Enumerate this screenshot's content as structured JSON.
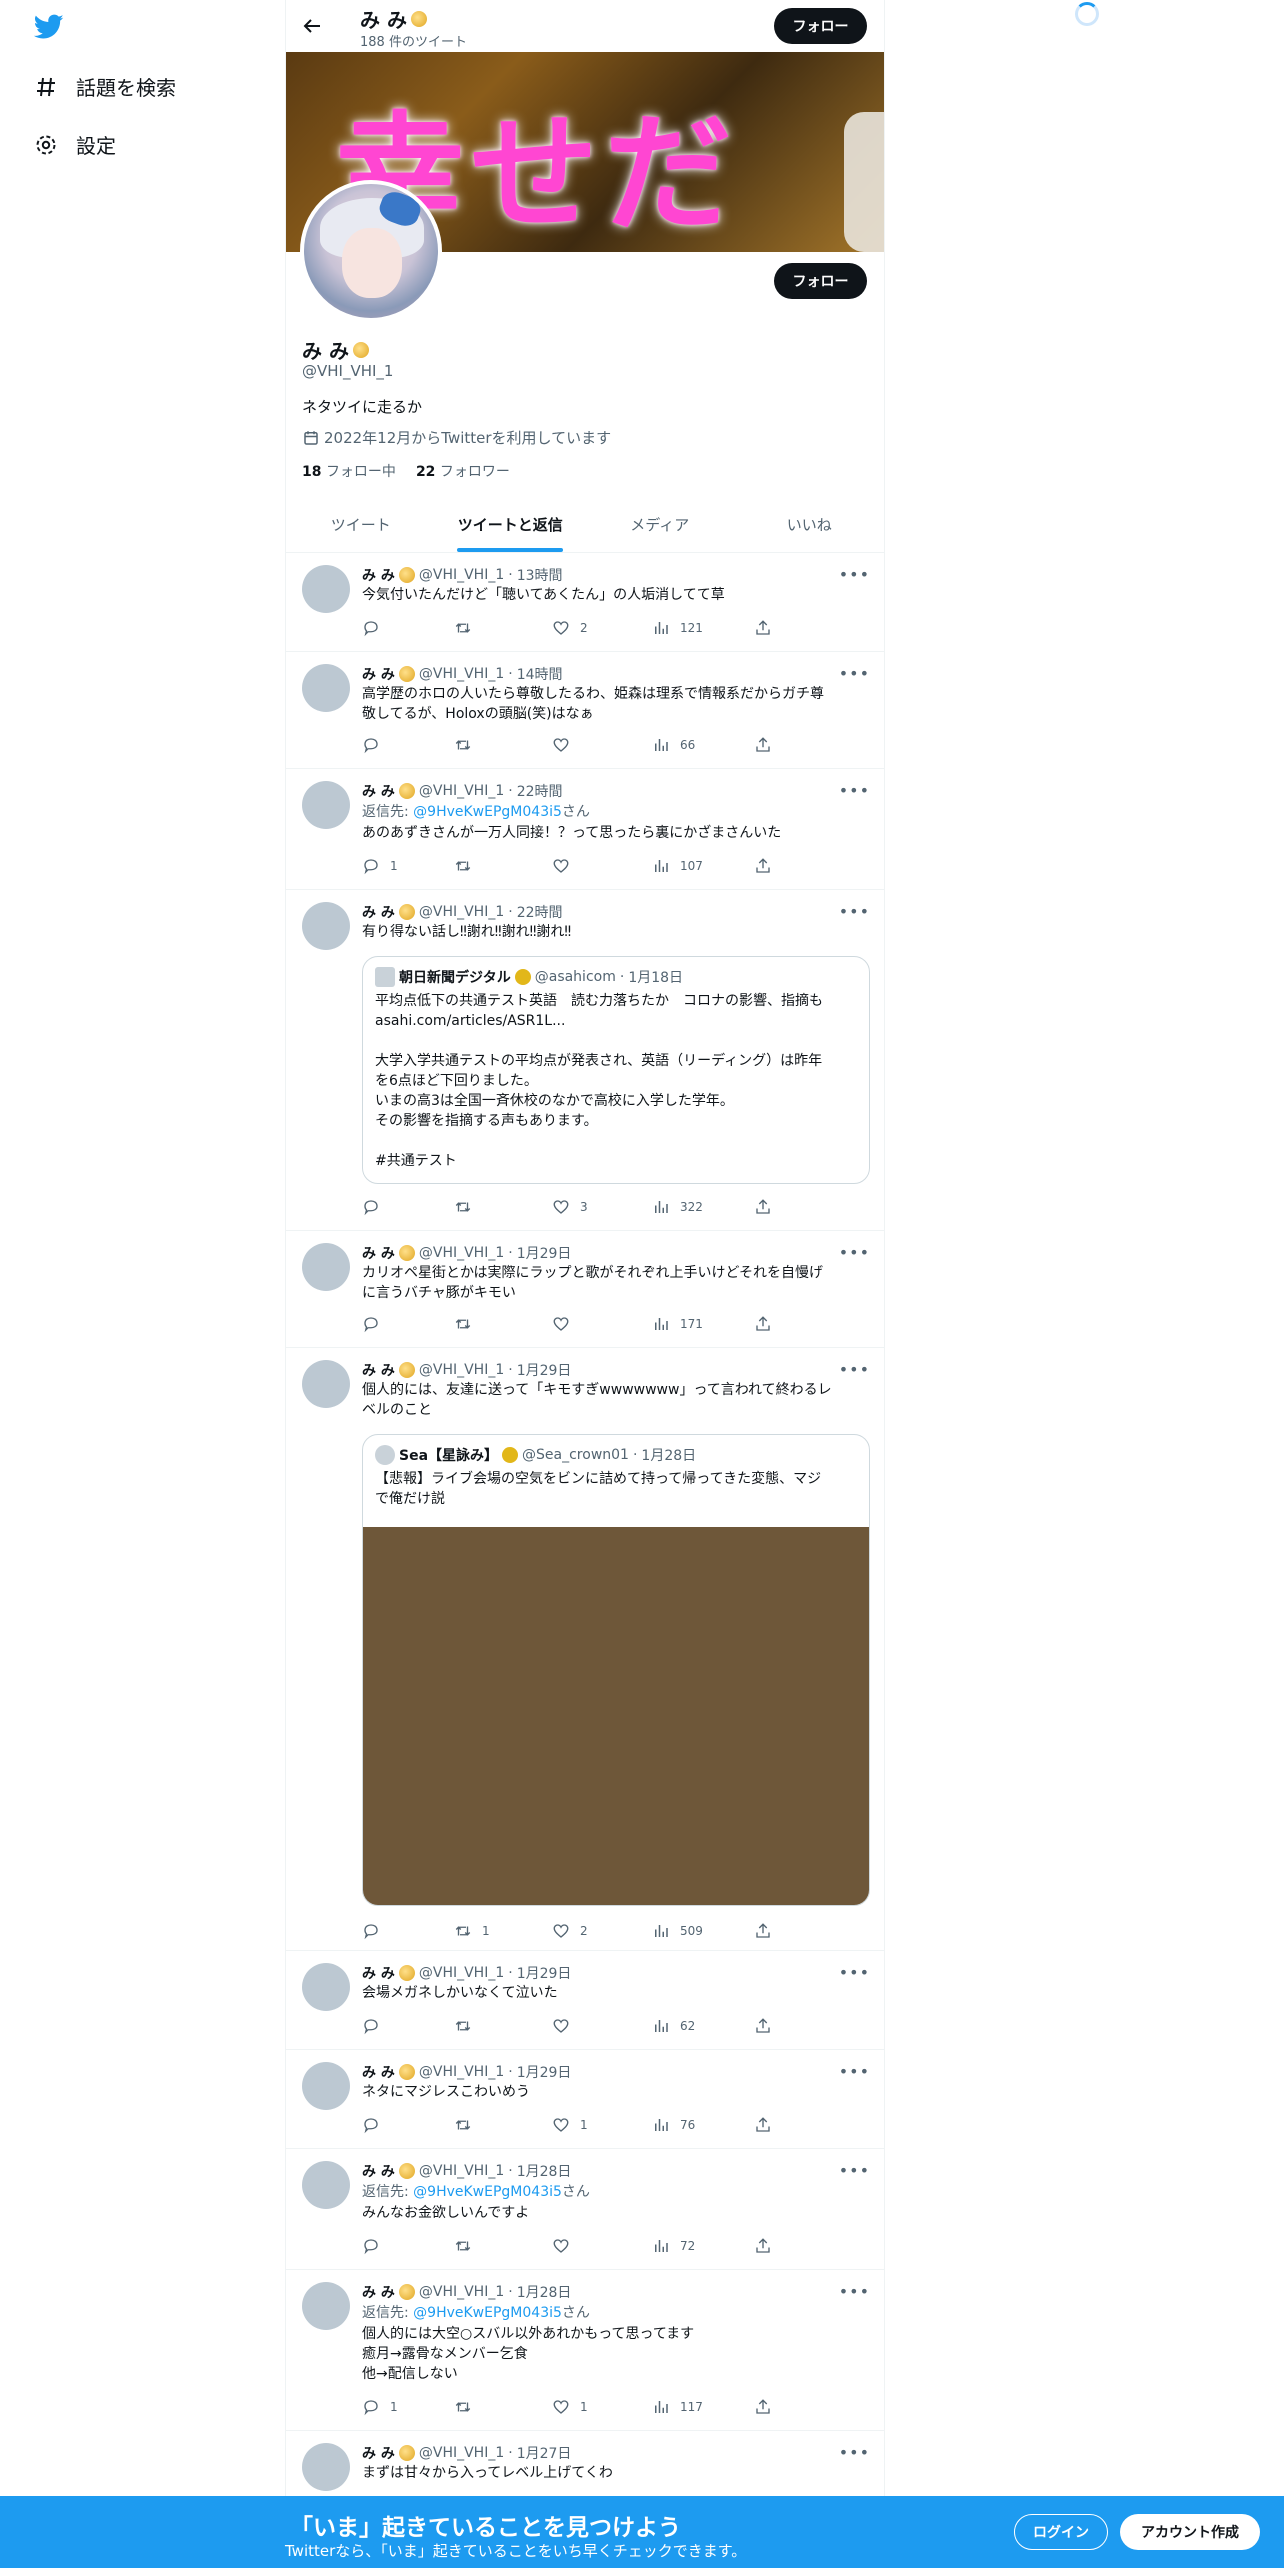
{
  "sidebar": {
    "items": [
      {
        "label": "話題を検索",
        "icon": "hashtag-icon"
      },
      {
        "label": "設定",
        "icon": "gear-icon"
      }
    ]
  },
  "header": {
    "name": "み み",
    "tweet_count": "188 件のツイート",
    "follow_label": "フォロー"
  },
  "banner": {
    "text": "幸せだ"
  },
  "profile": {
    "name": "み み",
    "handle": "@VHI_VHI_1",
    "bio": "ネタツイに走るか",
    "joined": "2022年12月からTwitterを利用しています",
    "following_count": "18",
    "following_label": "フォロー中",
    "followers_count": "22",
    "followers_label": "フォロワー",
    "follow_label": "フォロー"
  },
  "tabs": [
    {
      "label": "ツイート",
      "active": false
    },
    {
      "label": "ツイートと返信",
      "active": true
    },
    {
      "label": "メディア",
      "active": false
    },
    {
      "label": "いいね",
      "active": false
    }
  ],
  "tweets": [
    {
      "name": "み み",
      "handle": "@VHI_VHI_1",
      "time": "13時間",
      "reply_prefix": "",
      "reply_to": "",
      "reply_suffix": "",
      "text": "今気付いたんだけど「聴いてあくたん」の人垢消してて草",
      "retweets": "",
      "likes": "2",
      "views": "121"
    },
    {
      "name": "み み",
      "handle": "@VHI_VHI_1",
      "time": "14時間",
      "reply_prefix": "",
      "reply_to": "",
      "reply_suffix": "",
      "text": "高学歴のホロの人いたら尊敬したるわ、姫森は理系で情報系だからガチ尊\n敬してるが、Holoxの頭脳(笑)はなぁ",
      "retweets": "",
      "likes": "",
      "views": "66"
    },
    {
      "name": "み み",
      "handle": "@VHI_VHI_1",
      "time": "22時間",
      "reply_prefix": "返信先: ",
      "reply_to": "@9HveKwEPgM043i5",
      "reply_suffix": "さん",
      "text": "あのあずきさんが一万人同接！？って思ったら裏にかざまさんいた",
      "replies": "1",
      "retweets": "",
      "likes": "",
      "views": "107"
    },
    {
      "name": "み み",
      "handle": "@VHI_VHI_1",
      "time": "22時間",
      "reply_prefix": "",
      "reply_to": "",
      "reply_suffix": "",
      "text": "有り得ない話し‼謝れ‼謝れ‼謝れ‼",
      "retweets": "",
      "likes": "3",
      "views": "322",
      "quote": {
        "name": "朝日新聞デジタル",
        "handle": "@asahicom",
        "time": "1月18日",
        "text": "平均点低下の共通テスト英語　読む力落ちたか　コロナの影響、指摘も\nasahi.com/articles/ASR1L...\n\n大学入学共通テストの平均点が発表され、英語（リーディング）は昨年\nを6点ほど下回りました。\nいまの高3は全国一斉休校のなかで高校に入学した学年。\nその影響を指摘する声もあります。\n\n#共通テスト"
      }
    },
    {
      "name": "み み",
      "handle": "@VHI_VHI_1",
      "time": "1月29日",
      "reply_prefix": "",
      "reply_to": "",
      "reply_suffix": "",
      "text": "カリオペ星街とかは実際にラップと歌がそれぞれ上手いけどそれを自慢げ\nに言うバチャ豚がキモい",
      "retweets": "",
      "likes": "",
      "views": "171"
    },
    {
      "name": "み み",
      "handle": "@VHI_VHI_1",
      "time": "1月29日",
      "reply_prefix": "",
      "reply_to": "",
      "reply_suffix": "",
      "text": "個人的には、友達に送って「キモすぎwwwwwww」って言われて終わるレ\nベルのこと",
      "retweets": "1",
      "likes": "2",
      "views": "509",
      "quote": {
        "name": "Sea【星詠み】",
        "handle": "@Sea_crown01",
        "time": "1月28日",
        "text": "【悲報】ライブ会場の空気をビンに詰めて持って帰ってきた変態、マジ\nで俺だけ説"
      }
    },
    {
      "name": "み み",
      "handle": "@VHI_VHI_1",
      "time": "1月29日",
      "reply_prefix": "",
      "reply_to": "",
      "reply_suffix": "",
      "text": "会場メガネしかいなくて泣いた",
      "retweets": "",
      "likes": "",
      "views": "62"
    },
    {
      "name": "み み",
      "handle": "@VHI_VHI_1",
      "time": "1月29日",
      "reply_prefix": "",
      "reply_to": "",
      "reply_suffix": "",
      "text": "ネタにマジレスこわいめう",
      "retweets": "",
      "likes": "1",
      "views": "76"
    },
    {
      "name": "み み",
      "handle": "@VHI_VHI_1",
      "time": "1月28日",
      "reply_prefix": "返信先: ",
      "reply_to": "@9HveKwEPgM043i5",
      "reply_suffix": "さん",
      "text": "みんなお金欲しいんですよ",
      "retweets": "",
      "likes": "",
      "views": "72"
    },
    {
      "name": "み み",
      "handle": "@VHI_VHI_1",
      "time": "1月28日",
      "reply_prefix": "返信先: ",
      "reply_to": "@9HveKwEPgM043i5",
      "reply_suffix": "さん",
      "text": "個人的には大空○スバル以外あれかもって思ってます\n癒月→露骨なメンバー乞食\n他→配信しない",
      "replies": "1",
      "retweets": "",
      "likes": "1",
      "views": "117"
    },
    {
      "name": "み み",
      "handle": "@VHI_VHI_1",
      "time": "1月27日",
      "reply_prefix": "",
      "reply_to": "",
      "reply_suffix": "",
      "text": "まずは甘々から入ってレベル上げてくわ"
    }
  ],
  "bottom_bar": {
    "title": "「いま」起きていることを見つけよう",
    "subtitle": "Twitterなら、「いま」起きていることをいち早くチェックできます。",
    "login": "ログイン",
    "signup": "アカウント作成"
  },
  "colors": {
    "accent": "#1d9bf0",
    "text": "#0f1419",
    "muted": "#536471",
    "follow_button": "#0f1419"
  }
}
